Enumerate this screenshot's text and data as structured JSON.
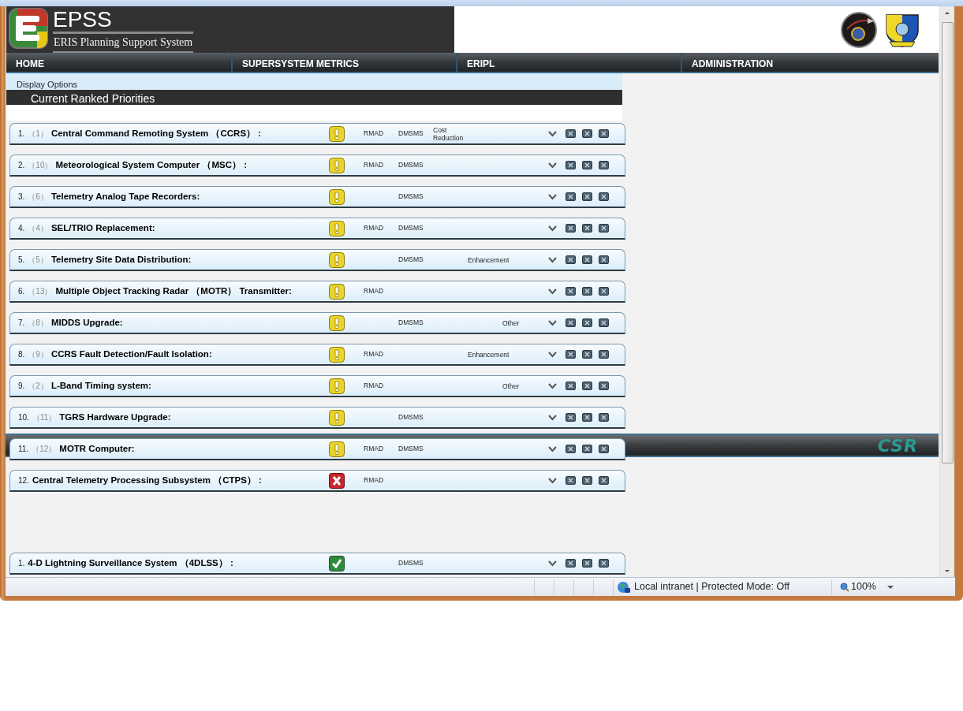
{
  "header": {
    "title": "EPSS",
    "subtitle": "ERIS Planning Support System"
  },
  "nav": [
    {
      "label": "HOME"
    },
    {
      "label": "SUPERSYSTEM METRICS"
    },
    {
      "label": "ERIPL"
    },
    {
      "label": "ADMINISTRATION"
    }
  ],
  "display_options": "Display Options",
  "section_title": "Current Ranked Priorities",
  "priorities": [
    {
      "number": "1.",
      "rank": "（1）",
      "name": "Central Command Remoting System （CCRS） :",
      "kind": "warning",
      "rmad": "RMAD",
      "dmsms": "DMSMS",
      "category": {
        "kind": "cost",
        "label": "Cost Reduction"
      }
    },
    {
      "number": "2.",
      "rank": "（10）",
      "name": "Meteorological System Computer （MSC） :",
      "kind": "warning",
      "rmad": "RMAD",
      "dmsms": "DMSMS"
    },
    {
      "number": "3.",
      "rank": "（6）",
      "name": "Telemetry Analog Tape Recorders:",
      "kind": "warning",
      "dmsms": "DMSMS"
    },
    {
      "number": "4.",
      "rank": "（4）",
      "name": "SEL/TRIO Replacement:",
      "kind": "warning",
      "rmad": "RMAD",
      "dmsms": "DMSMS"
    },
    {
      "number": "5.",
      "rank": "（5）",
      "name": "Telemetry Site Data Distribution:",
      "kind": "warning",
      "dmsms": "DMSMS",
      "category": {
        "kind": "enhancement",
        "label": "Enhancement"
      }
    },
    {
      "number": "6.",
      "rank": "（13）",
      "name": "Multiple Object Tracking Radar （MOTR） Transmitter:",
      "kind": "warning",
      "rmad": "RMAD"
    },
    {
      "number": "7.",
      "rank": "（8）",
      "name": "MIDDS Upgrade:",
      "kind": "warning",
      "dmsms": "DMSMS",
      "category": {
        "kind": "other",
        "label": "Other"
      }
    },
    {
      "number": "8.",
      "rank": "（9）",
      "name": "CCRS Fault Detection/Fault Isolation:",
      "kind": "warning",
      "rmad": "RMAD",
      "category": {
        "kind": "enhancement",
        "label": "Enhancement"
      }
    },
    {
      "number": "9.",
      "rank": "（2）",
      "name": "L-Band Timing system:",
      "kind": "warning",
      "rmad": "RMAD",
      "category": {
        "kind": "other",
        "label": "Other"
      }
    },
    {
      "number": "10.",
      "rank": "（11）",
      "name": "TGRS Hardware Upgrade:",
      "kind": "warning",
      "dmsms": "DMSMS"
    },
    {
      "number": "11.",
      "rank": "（12）",
      "name": "MOTR Computer:",
      "kind": "warning",
      "rmad": "RMAD",
      "dmsms": "DMSMS"
    },
    {
      "number": "12.",
      "name": "Central Telemetry Processing Subsystem （CTPS） :",
      "kind": "error",
      "rmad": "RMAD"
    }
  ],
  "other_priorities": [
    {
      "number": "1.",
      "name": "4-D Lightning Surveillance System （4DLSS） :",
      "kind": "ok",
      "dmsms": "DMSMS"
    }
  ],
  "footer": {
    "logo": "CSR"
  },
  "status_bar": {
    "zone": "Local intranet | Protected Mode: Off",
    "zoom": "100%"
  }
}
